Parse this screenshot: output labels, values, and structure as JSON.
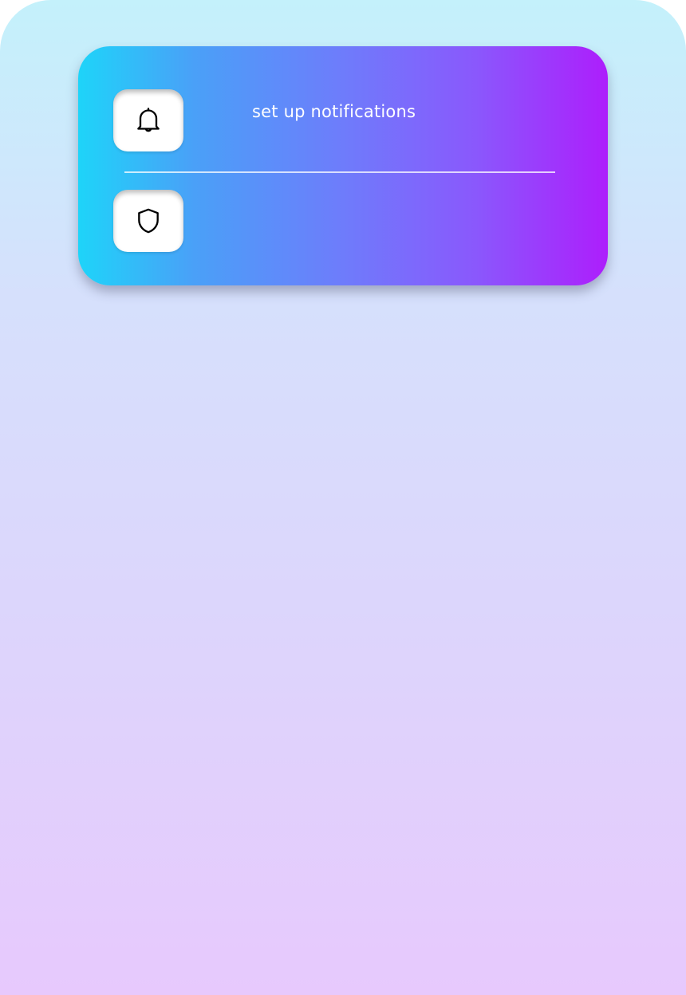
{
  "menu": {
    "items": [
      {
        "icon": "bell-icon",
        "label": "set up notifications"
      },
      {
        "icon": "shield-icon",
        "label": ""
      }
    ]
  }
}
